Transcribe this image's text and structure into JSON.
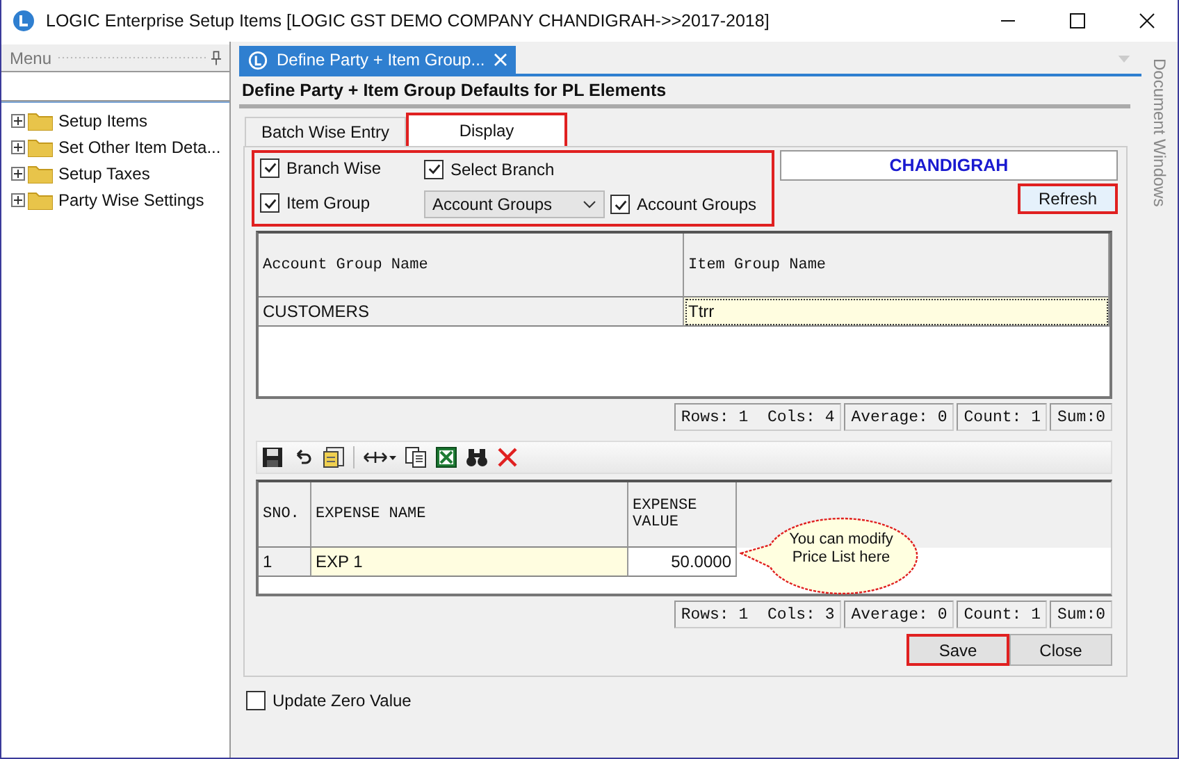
{
  "window": {
    "title": "LOGIC Enterprise Setup Items  [LOGIC GST DEMO COMPANY CHANDIGRAH->>2017-2018]"
  },
  "menu": {
    "title": "Menu",
    "items": [
      {
        "label": "Setup Items",
        "expanded": false
      },
      {
        "label": "Set Other Item Deta...",
        "expanded": false
      },
      {
        "label": "Setup Taxes",
        "expanded": false
      },
      {
        "label": "Party Wise Settings",
        "expanded": false
      }
    ]
  },
  "document_tab": {
    "label": "Define Party + Item Group...",
    "selected": true
  },
  "side_panel": {
    "label": "Document Windows"
  },
  "heading": "Define Party + Item Group Defaults for PL Elements",
  "tabs": [
    {
      "label": "Batch Wise Entry",
      "selected": false,
      "highlighted": false
    },
    {
      "label": "Display",
      "selected": true,
      "highlighted": true
    }
  ],
  "filters": {
    "highlighted": true,
    "branch_wise": {
      "label": "Branch Wise",
      "checked": true
    },
    "select_branch": {
      "label": "Select Branch",
      "checked": true
    },
    "item_group": {
      "label": "Item Group",
      "checked": true
    },
    "group_type": {
      "value": "Account Groups"
    },
    "account_groups": {
      "label": "Account Groups",
      "checked": true
    }
  },
  "branch": {
    "value": "CHANDIGRAH"
  },
  "refresh_button": {
    "label": "Refresh",
    "highlighted": true
  },
  "group_table": {
    "columns": [
      "Account Group Name",
      "Item Group Name"
    ],
    "rows": [
      {
        "cells": [
          {
            "text": "CUSTOMERS",
            "focused": false
          },
          {
            "text": "Ttrr",
            "focused": true
          }
        ]
      }
    ],
    "status": [
      "Rows: 1  Cols: 4",
      "Average: 0",
      "Count: 1",
      "Sum:0"
    ]
  },
  "expense_table": {
    "columns": [
      "SNO.",
      "EXPENSE NAME",
      "EXPENSE VALUE"
    ],
    "rows": [
      {
        "cells": [
          {
            "text": "1",
            "focused": false
          },
          {
            "text": "EXP 1",
            "focused": true
          },
          {
            "text": "50.0000",
            "focused": false
          }
        ]
      }
    ],
    "status": [
      "Rows: 1  Cols: 3",
      "Average: 0",
      "Count: 1",
      "Sum:0"
    ]
  },
  "callout": "You can modify Price List here",
  "buttons": [
    {
      "label": "Save",
      "highlighted": true
    },
    {
      "label": "Close",
      "highlighted": false
    }
  ],
  "update_zero_value": {
    "label": "Update Zero Value",
    "checked": false
  }
}
